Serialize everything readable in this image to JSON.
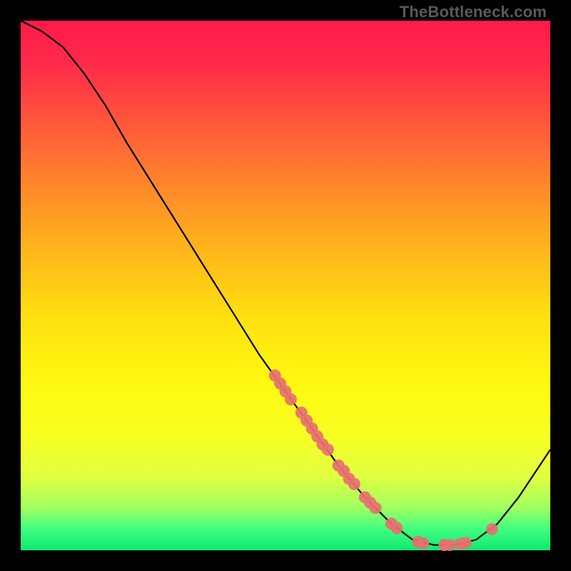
{
  "watermark": "TheBottleneck.com",
  "chart_data": {
    "type": "line",
    "title": "",
    "xlabel": "",
    "ylabel": "",
    "xlim": [
      0,
      100
    ],
    "ylim": [
      0,
      100
    ],
    "curve": [
      {
        "x": 0,
        "y": 100
      },
      {
        "x": 4,
        "y": 98
      },
      {
        "x": 8,
        "y": 95
      },
      {
        "x": 12,
        "y": 90
      },
      {
        "x": 16,
        "y": 84
      },
      {
        "x": 20,
        "y": 77
      },
      {
        "x": 25,
        "y": 69
      },
      {
        "x": 30,
        "y": 61
      },
      {
        "x": 35,
        "y": 53
      },
      {
        "x": 40,
        "y": 45
      },
      {
        "x": 45,
        "y": 37
      },
      {
        "x": 50,
        "y": 30
      },
      {
        "x": 55,
        "y": 23
      },
      {
        "x": 60,
        "y": 16
      },
      {
        "x": 65,
        "y": 10
      },
      {
        "x": 70,
        "y": 5
      },
      {
        "x": 74,
        "y": 2
      },
      {
        "x": 78,
        "y": 1
      },
      {
        "x": 82,
        "y": 1
      },
      {
        "x": 86,
        "y": 2
      },
      {
        "x": 90,
        "y": 5
      },
      {
        "x": 94,
        "y": 10
      },
      {
        "x": 98,
        "y": 16
      },
      {
        "x": 100,
        "y": 19
      }
    ],
    "markers": [
      {
        "x": 48,
        "y": 33
      },
      {
        "x": 49,
        "y": 31.5
      },
      {
        "x": 50,
        "y": 30
      },
      {
        "x": 51,
        "y": 28.5
      },
      {
        "x": 53,
        "y": 26
      },
      {
        "x": 54,
        "y": 24.5
      },
      {
        "x": 55,
        "y": 23
      },
      {
        "x": 56,
        "y": 21.5
      },
      {
        "x": 57,
        "y": 20
      },
      {
        "x": 58,
        "y": 19
      },
      {
        "x": 60,
        "y": 16
      },
      {
        "x": 61,
        "y": 15
      },
      {
        "x": 62,
        "y": 13.5
      },
      {
        "x": 63,
        "y": 12.5
      },
      {
        "x": 65,
        "y": 10
      },
      {
        "x": 66,
        "y": 9
      },
      {
        "x": 67,
        "y": 8
      },
      {
        "x": 70,
        "y": 5
      },
      {
        "x": 71,
        "y": 4.2
      },
      {
        "x": 75,
        "y": 1.6
      },
      {
        "x": 76,
        "y": 1.3
      },
      {
        "x": 80,
        "y": 1
      },
      {
        "x": 81,
        "y": 1
      },
      {
        "x": 83,
        "y": 1.2
      },
      {
        "x": 84,
        "y": 1.4
      },
      {
        "x": 89,
        "y": 4
      }
    ],
    "marker_color": "#e87070",
    "line_color": "#000000"
  }
}
